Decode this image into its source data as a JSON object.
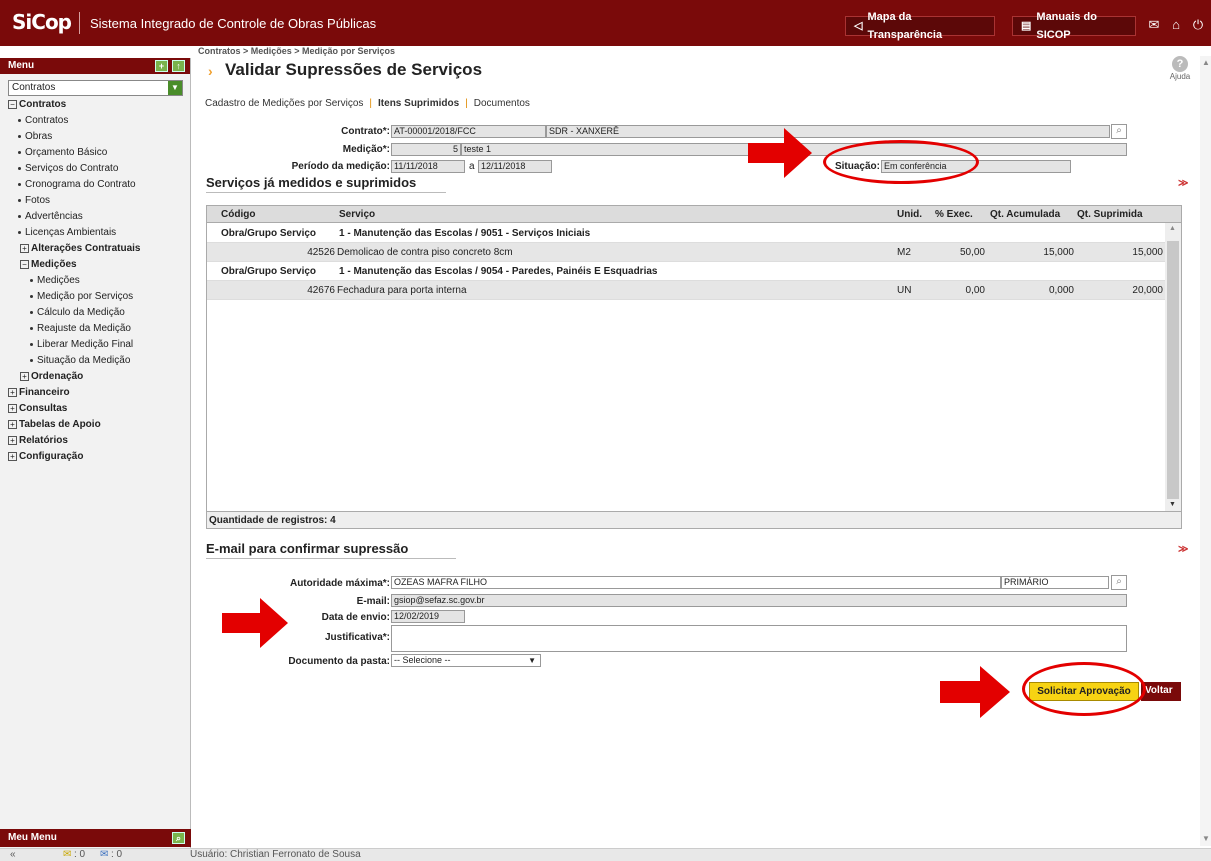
{
  "app": {
    "logo": "SiCop",
    "title": "Sistema Integrado de Controle de Obras Públicas",
    "btn_transparencia": "Mapa da Transparência",
    "btn_manuais": "Manuais do SICOP"
  },
  "sidebar": {
    "header": "Menu",
    "module_select": "Contratos",
    "items": [
      {
        "label": "Contratos",
        "level": 0,
        "expander": "minus"
      },
      {
        "label": "Contratos",
        "level": 1
      },
      {
        "label": "Obras",
        "level": 1
      },
      {
        "label": "Orçamento Básico",
        "level": 1
      },
      {
        "label": "Serviços do Contrato",
        "level": 1
      },
      {
        "label": "Cronograma do Contrato",
        "level": 1
      },
      {
        "label": "Fotos",
        "level": 1
      },
      {
        "label": "Advertências",
        "level": 1
      },
      {
        "label": "Licenças Ambientais",
        "level": 1
      },
      {
        "label": "Alterações Contratuais",
        "level": "1b",
        "expander": "plus"
      },
      {
        "label": "Medições",
        "level": "1b",
        "expander": "minus"
      },
      {
        "label": "Medições",
        "level": 2
      },
      {
        "label": "Medição por Serviços",
        "level": 2
      },
      {
        "label": "Cálculo da Medição",
        "level": 2
      },
      {
        "label": "Reajuste da Medição",
        "level": 2
      },
      {
        "label": "Liberar Medição Final",
        "level": 2
      },
      {
        "label": "Situação da Medição",
        "level": 2
      },
      {
        "label": "Ordenação",
        "level": "1b",
        "expander": "plus"
      },
      {
        "label": "Financeiro",
        "level": 0,
        "expander": "plus"
      },
      {
        "label": "Consultas",
        "level": 0,
        "expander": "plus"
      },
      {
        "label": "Tabelas de Apoio",
        "level": 0,
        "expander": "plus"
      },
      {
        "label": "Relatórios",
        "level": 0,
        "expander": "plus"
      },
      {
        "label": "Configuração",
        "level": 0,
        "expander": "plus"
      }
    ],
    "meu_menu": "Meu Menu"
  },
  "statusbar": {
    "collapse": "«",
    "mail_count": ": 0",
    "msg_count": ": 0",
    "user": "Usuário: Christian Ferronato de Sousa"
  },
  "page": {
    "breadcrumb": "Contratos > Medições > Medição por Serviços",
    "title": "Validar Supressões de Serviços",
    "help": "Ajuda",
    "tabs": [
      "Cadastro de Medições por Serviços",
      "Itens Suprimidos",
      "Documentos"
    ],
    "active_tab": "Itens Suprimidos"
  },
  "form": {
    "contrato_label": "Contrato*:",
    "contrato_value": "AT-00001/2018/FCC",
    "contrato_desc": "SDR - XANXERÊ",
    "medicao_label": "Medição*:",
    "medicao_num": "5",
    "medicao_desc": "teste 1",
    "periodo_label": "Período da medição:",
    "periodo_inicio": "11/11/2018",
    "periodo_a": "a",
    "periodo_fim": "12/11/2018",
    "situacao_label": "Situação:",
    "situacao_value": "Em conferência"
  },
  "grid": {
    "section_title": "Serviços já medidos e suprimidos",
    "columns": [
      "Código",
      "Serviço",
      "Unid.",
      "% Exec.",
      "Qt. Acumulada",
      "Qt. Suprimida"
    ],
    "rows": [
      {
        "type": "group",
        "label": "Obra/Grupo Serviço",
        "desc": "1 - Manutenção das Escolas / 9051 - Serviços Iniciais"
      },
      {
        "type": "item",
        "codigo": "42526",
        "servico": "Demolicao de contra piso concreto 8cm",
        "unid": "M2",
        "exec": "50,00",
        "acum": "15,000",
        "supr": "15,000"
      },
      {
        "type": "group",
        "label": "Obra/Grupo Serviço",
        "desc": "1 - Manutenção das Escolas / 9054 - Paredes, Painéis E Esquadrias"
      },
      {
        "type": "item",
        "codigo": "42676",
        "servico": "Fechadura para porta interna",
        "unid": "UN",
        "exec": "0,00",
        "acum": "0,000",
        "supr": "20,000"
      }
    ],
    "footer": "Quantidade de registros: 4"
  },
  "email": {
    "section_title": "E-mail para confirmar supressão",
    "autoridade_label": "Autoridade máxima*:",
    "autoridade_value": "OZEAS MAFRA FILHO",
    "autoridade_tipo": "PRIMÁRIO",
    "email_label": "E-mail:",
    "email_value": "gsiop@sefaz.sc.gov.br",
    "data_label": "Data de envio:",
    "data_value": "12/02/2019",
    "just_label": "Justificativa*:",
    "just_value": "",
    "doc_label": "Documento da pasta:",
    "doc_value": "-- Selecione --"
  },
  "actions": {
    "solicitar": "Solicitar Aprovação",
    "voltar": "Voltar"
  },
  "colors": {
    "brand": "#7a0a0a",
    "accent_button": "#f7d313",
    "annotation_red": "#e30000"
  }
}
